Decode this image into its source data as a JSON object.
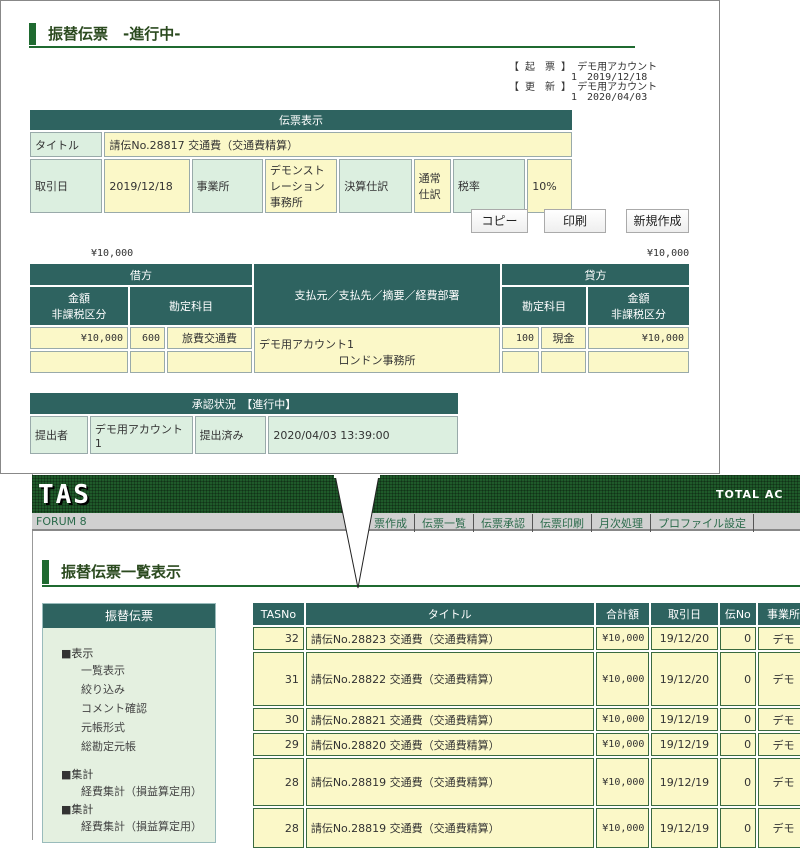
{
  "background": {
    "logo": "TAS",
    "tagline": "TOTAL AC",
    "brand": "FORUM 8",
    "nav": [
      "票作成",
      "伝票一覧",
      "伝票承認",
      "伝票印刷",
      "月次処理",
      "プロファイル設定"
    ],
    "page_title": "振替伝票一覧表示",
    "sidebar": {
      "header": "振替伝票",
      "groups": [
        {
          "label": "■表示",
          "items": [
            "一覧表示",
            "絞り込み",
            "コメント確認",
            "元帳形式",
            "総勘定元帳"
          ]
        },
        {
          "label": "■集計",
          "items": [
            "経費集計（損益算定用）"
          ]
        },
        {
          "label": "■集計",
          "items": [
            "経費集計（損益算定用）"
          ]
        }
      ]
    },
    "list": {
      "headers": [
        "TASNo",
        "タイトル",
        "合計額",
        "取引日",
        "伝No",
        "事業所"
      ],
      "rows": [
        [
          "32",
          "請伝No.28823 交通費（交通費精算）",
          "¥10,000",
          "19/12/20",
          "0",
          "デモ"
        ],
        [
          "31",
          "請伝No.28822 交通費（交通費精算）",
          "¥10,000",
          "19/12/20",
          "0",
          "デモ"
        ],
        [
          "30",
          "請伝No.28821 交通費（交通費精算）",
          "¥10,000",
          "19/12/19",
          "0",
          "デモ"
        ],
        [
          "29",
          "請伝No.28820 交通費（交通費精算）",
          "¥10,000",
          "19/12/19",
          "0",
          "デモ"
        ],
        [
          "28",
          "請伝No.28819 交通費（交通費精算）",
          "¥10,000",
          "19/12/19",
          "0",
          "デモ"
        ],
        [
          "28",
          "請伝No.28819 交通費（交通費精算）",
          "¥10,000",
          "19/12/19",
          "0",
          "デモ"
        ]
      ]
    }
  },
  "popup": {
    "title": "振替伝票　-進行中-",
    "meta": {
      "created_label": "【 起　票 】",
      "created_by": "デモ用アカウント",
      "created_line2": "1　2019/12/18",
      "updated_label": "【 更　新 】",
      "updated_by": "デモ用アカウント",
      "updated_line2": "1　2020/04/03"
    },
    "info": {
      "header": "伝票表示",
      "title_label": "タイトル",
      "title_value": "請伝No.28817 交通費（交通費精算）",
      "date_label": "取引日",
      "date_value": "2019/12/18",
      "office_label": "事業所",
      "office_value": "デモンストレーション事務所",
      "settle_label": "決算仕訳",
      "settle_value": "通常仕訳",
      "tax_label": "税率",
      "tax_value": "10%"
    },
    "buttons": {
      "copy": "コピー",
      "print": "印刷",
      "new": "新規作成"
    },
    "totals": {
      "debit": "¥10,000",
      "credit": "¥10,000"
    },
    "journal": {
      "debit": "借方",
      "credit": "貸方",
      "amount": "金額",
      "tax_class": "非課税区分",
      "account": "勘定科目",
      "middle": "支払元／支払先／摘要／経費部署",
      "debit_amount": "¥10,000",
      "debit_code": "600",
      "debit_account": "旅費交通費",
      "payee": "デモ用アカウント1",
      "dept": "ロンドン事務所",
      "credit_code": "100",
      "credit_account": "現金",
      "credit_amount": "¥10,000"
    },
    "approval": {
      "header": "承認状況　【進行中】",
      "submitter_label": "提出者",
      "submitter": "デモ用アカウント1",
      "status": "提出済み",
      "datetime": "2020/04/03 13:39:00"
    }
  }
}
